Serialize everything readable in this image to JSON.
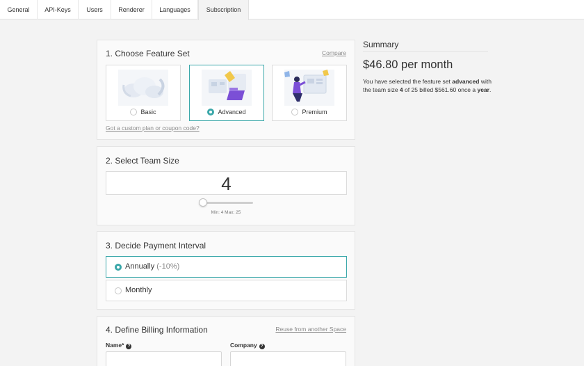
{
  "tabs": [
    {
      "label": "General"
    },
    {
      "label": "API-Keys"
    },
    {
      "label": "Users"
    },
    {
      "label": "Renderer"
    },
    {
      "label": "Languages"
    },
    {
      "label": "Subscription"
    }
  ],
  "feature_card": {
    "title": "1. Choose Feature Set",
    "compare_link": "Compare",
    "coupon_link": "Got a custom plan or coupon code?",
    "options": [
      {
        "label": "Basic",
        "icon": "cloud-illustration",
        "selected": false
      },
      {
        "label": "Advanced",
        "icon": "folder-cards-illustration",
        "selected": true
      },
      {
        "label": "Premium",
        "icon": "person-board-illustration",
        "selected": false
      }
    ]
  },
  "team_card": {
    "title": "2. Select Team Size",
    "value": "4",
    "minmax": "Min: 4 Max: 25",
    "slider_fraction": 0
  },
  "payment_card": {
    "title": "3. Decide Payment Interval",
    "options": [
      {
        "label": "Annually",
        "discount": "(-10%)",
        "selected": true
      },
      {
        "label": "Monthly",
        "discount": "",
        "selected": false
      }
    ]
  },
  "billing_card": {
    "title": "4. Define Billing Information",
    "reuse_link": "Reuse from another Space",
    "name_label": "Name*",
    "company_label": "Company"
  },
  "summary": {
    "title": "Summary",
    "price": "$46.80 per month",
    "t1": "You have selected the feature set ",
    "feature": "advanced",
    "t2": " with the team size ",
    "team_size": "4",
    "t3": " of 25 billed $561.60 once a ",
    "period": "year",
    "t4": "."
  },
  "colors": {
    "accent": "#3aa7a9",
    "illustration_purple": "#7b4fd6",
    "illustration_yellow": "#f1c84b"
  }
}
